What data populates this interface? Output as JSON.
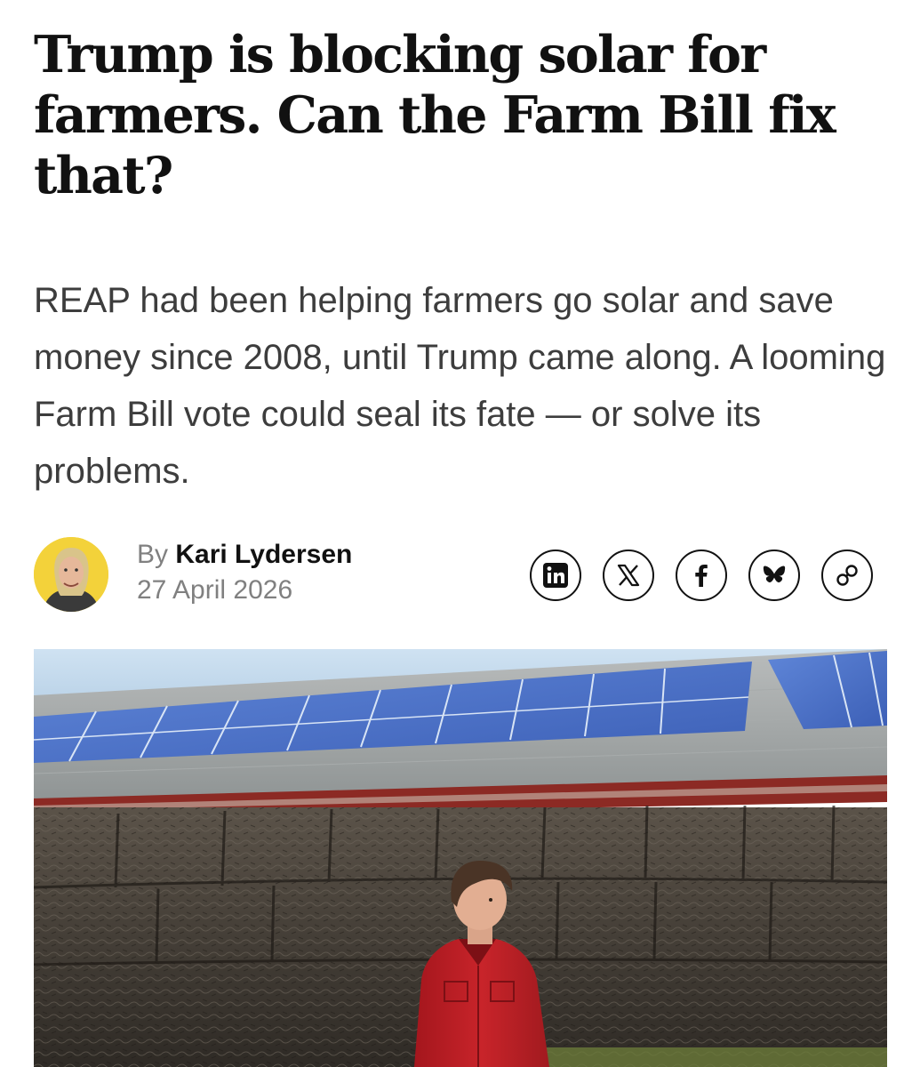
{
  "article": {
    "headline": "Trump is blocking solar for farmers. Can the Farm Bill fix that?",
    "dek": "REAP had been helping farmers go solar and save money since 2008, until Trump came along. A looming Farm Bill vote could seal its fate — or solve its problems.",
    "byline": {
      "prefix": "By",
      "author": "Kari Lydersen",
      "date": "27 April 2026"
    },
    "share_buttons": [
      {
        "icon": "linkedin-icon",
        "label": "in"
      },
      {
        "icon": "x-icon",
        "label": "X"
      },
      {
        "icon": "facebook-icon",
        "label": "f"
      },
      {
        "icon": "bluesky-icon",
        "label": ""
      },
      {
        "icon": "link-icon",
        "label": ""
      }
    ]
  },
  "colors": {
    "text": "#111111",
    "dek": "#3d3d3d",
    "muted": "#808080",
    "avatar_bg": "#f3d23a"
  }
}
